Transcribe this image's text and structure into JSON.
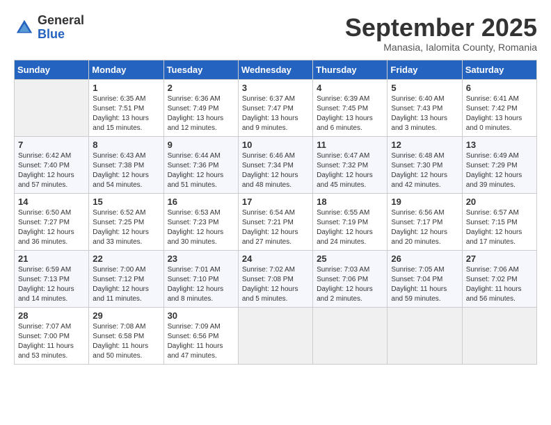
{
  "header": {
    "logo": {
      "general": "General",
      "blue": "Blue"
    },
    "title": "September 2025",
    "subtitle": "Manasia, Ialomita County, Romania"
  },
  "days_of_week": [
    "Sunday",
    "Monday",
    "Tuesday",
    "Wednesday",
    "Thursday",
    "Friday",
    "Saturday"
  ],
  "weeks": [
    [
      {
        "empty": true
      },
      {
        "day": "1",
        "sunrise": "Sunrise: 6:35 AM",
        "sunset": "Sunset: 7:51 PM",
        "daylight": "Daylight: 13 hours and 15 minutes."
      },
      {
        "day": "2",
        "sunrise": "Sunrise: 6:36 AM",
        "sunset": "Sunset: 7:49 PM",
        "daylight": "Daylight: 13 hours and 12 minutes."
      },
      {
        "day": "3",
        "sunrise": "Sunrise: 6:37 AM",
        "sunset": "Sunset: 7:47 PM",
        "daylight": "Daylight: 13 hours and 9 minutes."
      },
      {
        "day": "4",
        "sunrise": "Sunrise: 6:39 AM",
        "sunset": "Sunset: 7:45 PM",
        "daylight": "Daylight: 13 hours and 6 minutes."
      },
      {
        "day": "5",
        "sunrise": "Sunrise: 6:40 AM",
        "sunset": "Sunset: 7:43 PM",
        "daylight": "Daylight: 13 hours and 3 minutes."
      },
      {
        "day": "6",
        "sunrise": "Sunrise: 6:41 AM",
        "sunset": "Sunset: 7:42 PM",
        "daylight": "Daylight: 13 hours and 0 minutes."
      }
    ],
    [
      {
        "day": "7",
        "sunrise": "Sunrise: 6:42 AM",
        "sunset": "Sunset: 7:40 PM",
        "daylight": "Daylight: 12 hours and 57 minutes."
      },
      {
        "day": "8",
        "sunrise": "Sunrise: 6:43 AM",
        "sunset": "Sunset: 7:38 PM",
        "daylight": "Daylight: 12 hours and 54 minutes."
      },
      {
        "day": "9",
        "sunrise": "Sunrise: 6:44 AM",
        "sunset": "Sunset: 7:36 PM",
        "daylight": "Daylight: 12 hours and 51 minutes."
      },
      {
        "day": "10",
        "sunrise": "Sunrise: 6:46 AM",
        "sunset": "Sunset: 7:34 PM",
        "daylight": "Daylight: 12 hours and 48 minutes."
      },
      {
        "day": "11",
        "sunrise": "Sunrise: 6:47 AM",
        "sunset": "Sunset: 7:32 PM",
        "daylight": "Daylight: 12 hours and 45 minutes."
      },
      {
        "day": "12",
        "sunrise": "Sunrise: 6:48 AM",
        "sunset": "Sunset: 7:30 PM",
        "daylight": "Daylight: 12 hours and 42 minutes."
      },
      {
        "day": "13",
        "sunrise": "Sunrise: 6:49 AM",
        "sunset": "Sunset: 7:29 PM",
        "daylight": "Daylight: 12 hours and 39 minutes."
      }
    ],
    [
      {
        "day": "14",
        "sunrise": "Sunrise: 6:50 AM",
        "sunset": "Sunset: 7:27 PM",
        "daylight": "Daylight: 12 hours and 36 minutes."
      },
      {
        "day": "15",
        "sunrise": "Sunrise: 6:52 AM",
        "sunset": "Sunset: 7:25 PM",
        "daylight": "Daylight: 12 hours and 33 minutes."
      },
      {
        "day": "16",
        "sunrise": "Sunrise: 6:53 AM",
        "sunset": "Sunset: 7:23 PM",
        "daylight": "Daylight: 12 hours and 30 minutes."
      },
      {
        "day": "17",
        "sunrise": "Sunrise: 6:54 AM",
        "sunset": "Sunset: 7:21 PM",
        "daylight": "Daylight: 12 hours and 27 minutes."
      },
      {
        "day": "18",
        "sunrise": "Sunrise: 6:55 AM",
        "sunset": "Sunset: 7:19 PM",
        "daylight": "Daylight: 12 hours and 24 minutes."
      },
      {
        "day": "19",
        "sunrise": "Sunrise: 6:56 AM",
        "sunset": "Sunset: 7:17 PM",
        "daylight": "Daylight: 12 hours and 20 minutes."
      },
      {
        "day": "20",
        "sunrise": "Sunrise: 6:57 AM",
        "sunset": "Sunset: 7:15 PM",
        "daylight": "Daylight: 12 hours and 17 minutes."
      }
    ],
    [
      {
        "day": "21",
        "sunrise": "Sunrise: 6:59 AM",
        "sunset": "Sunset: 7:13 PM",
        "daylight": "Daylight: 12 hours and 14 minutes."
      },
      {
        "day": "22",
        "sunrise": "Sunrise: 7:00 AM",
        "sunset": "Sunset: 7:12 PM",
        "daylight": "Daylight: 12 hours and 11 minutes."
      },
      {
        "day": "23",
        "sunrise": "Sunrise: 7:01 AM",
        "sunset": "Sunset: 7:10 PM",
        "daylight": "Daylight: 12 hours and 8 minutes."
      },
      {
        "day": "24",
        "sunrise": "Sunrise: 7:02 AM",
        "sunset": "Sunset: 7:08 PM",
        "daylight": "Daylight: 12 hours and 5 minutes."
      },
      {
        "day": "25",
        "sunrise": "Sunrise: 7:03 AM",
        "sunset": "Sunset: 7:06 PM",
        "daylight": "Daylight: 12 hours and 2 minutes."
      },
      {
        "day": "26",
        "sunrise": "Sunrise: 7:05 AM",
        "sunset": "Sunset: 7:04 PM",
        "daylight": "Daylight: 11 hours and 59 minutes."
      },
      {
        "day": "27",
        "sunrise": "Sunrise: 7:06 AM",
        "sunset": "Sunset: 7:02 PM",
        "daylight": "Daylight: 11 hours and 56 minutes."
      }
    ],
    [
      {
        "day": "28",
        "sunrise": "Sunrise: 7:07 AM",
        "sunset": "Sunset: 7:00 PM",
        "daylight": "Daylight: 11 hours and 53 minutes."
      },
      {
        "day": "29",
        "sunrise": "Sunrise: 7:08 AM",
        "sunset": "Sunset: 6:58 PM",
        "daylight": "Daylight: 11 hours and 50 minutes."
      },
      {
        "day": "30",
        "sunrise": "Sunrise: 7:09 AM",
        "sunset": "Sunset: 6:56 PM",
        "daylight": "Daylight: 11 hours and 47 minutes."
      },
      {
        "empty": true
      },
      {
        "empty": true
      },
      {
        "empty": true
      },
      {
        "empty": true
      }
    ]
  ]
}
